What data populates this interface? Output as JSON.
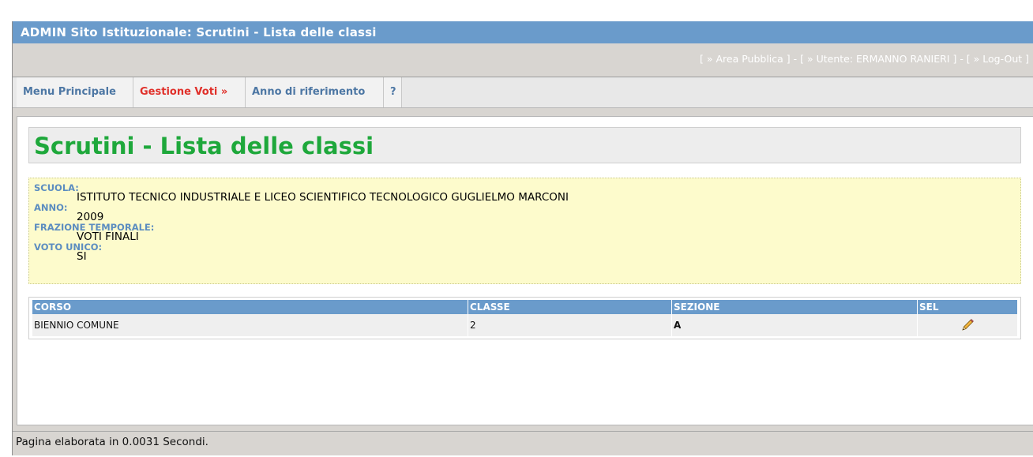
{
  "window": {
    "title": "ADMIN Sito Istituzionale: Scrutini - Lista delle classi"
  },
  "toplinks": {
    "open1": "[ ",
    "area_pubblica": "» Area Pubblica",
    "sep1": " ] - [ ",
    "utente": "» Utente: ERMANNO RANIERI",
    "sep2": " ] - [ ",
    "logout": "» Log-Out",
    "close": " ]"
  },
  "menu": {
    "items": [
      {
        "label": "Menu Principale",
        "active": false
      },
      {
        "label": "Gestione Voti »",
        "active": true
      },
      {
        "label": "Anno di riferimento",
        "active": false
      },
      {
        "label": "?",
        "active": false
      }
    ]
  },
  "page": {
    "title": "Scrutini - Lista delle classi"
  },
  "info": {
    "scuola_label": "SCUOLA:",
    "scuola_value": "ISTITUTO TECNICO INDUSTRIALE E LICEO SCIENTIFICO TECNOLOGICO GUGLIELMO MARCONI",
    "anno_label": "ANNO:",
    "anno_value": "2009",
    "frazione_label": "FRAZIONE TEMPORALE:",
    "frazione_value": "VOTI FINALI",
    "voto_label": "VOTO UNICO:",
    "voto_value": "SI"
  },
  "table": {
    "headers": [
      "CORSO",
      "CLASSE",
      "SEZIONE",
      "SEL"
    ],
    "rows": [
      {
        "corso": "BIENNIO COMUNE",
        "classe": "2",
        "sezione": "A",
        "sel_icon": "pencil-icon"
      }
    ]
  },
  "status": {
    "text": "Pagina elaborata in 0.0031 Secondi."
  },
  "colors": {
    "accent_blue": "#6a9bcb",
    "title_green": "#1ea83b",
    "active_red": "#e0302a",
    "info_yellow": "#fdfbcc"
  }
}
